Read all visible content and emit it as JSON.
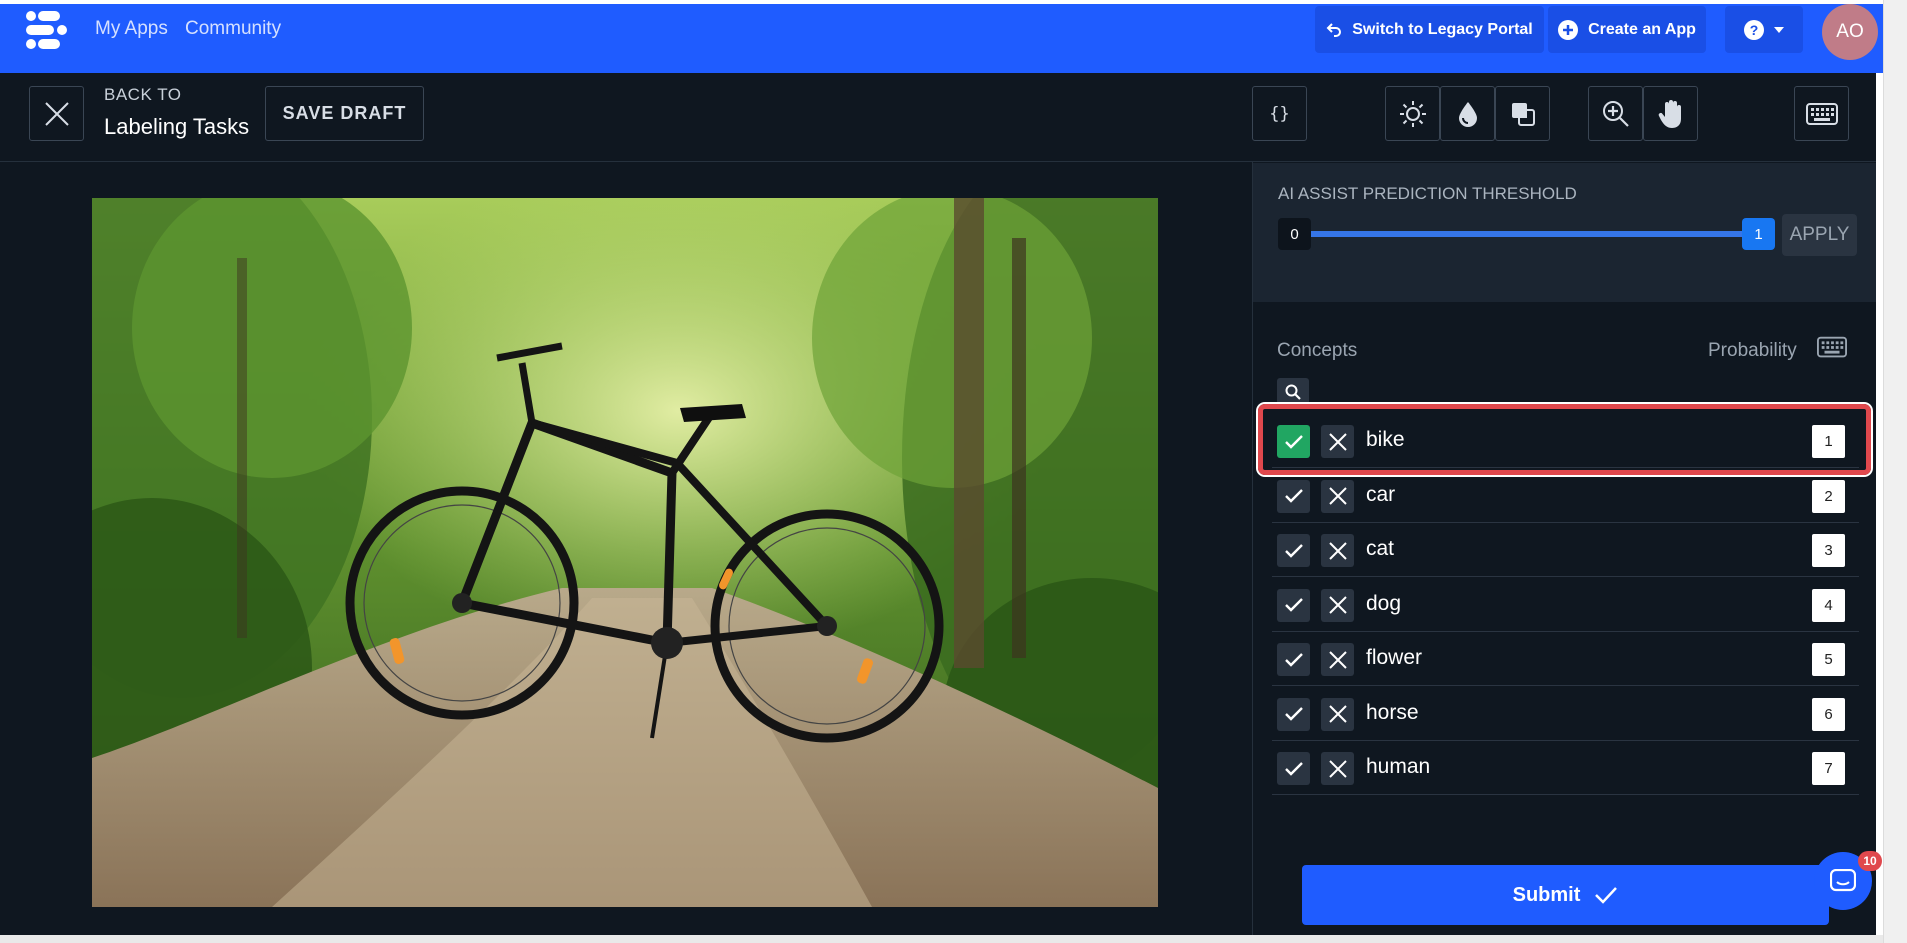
{
  "topnav": {
    "links": [
      "My Apps",
      "Community"
    ],
    "legacy_label": "Switch to Legacy Portal",
    "create_label": "Create an App",
    "avatar_initials": "AO",
    "bg_color": "#1f5cff"
  },
  "toolbar": {
    "back_small": "BACK TO",
    "back_title": "Labeling Tasks",
    "save_draft": "SAVE DRAFT",
    "icons": [
      "close-icon",
      "json-icon",
      "brightness-icon",
      "saturation-icon",
      "contrast-icon",
      "zoom-in-icon",
      "pan-hand-icon",
      "keyboard-icon"
    ]
  },
  "image": {
    "subject": "bike"
  },
  "threshold": {
    "title": "AI ASSIST PREDICTION THRESHOLD",
    "min": "0",
    "max": "1",
    "value": 1,
    "apply_label": "APPLY"
  },
  "concepts": {
    "header_concepts": "Concepts",
    "header_probability": "Probability",
    "items": [
      {
        "label": "bike",
        "shortcut": "1",
        "accepted": true
      },
      {
        "label": "car",
        "shortcut": "2",
        "accepted": false
      },
      {
        "label": "cat",
        "shortcut": "3",
        "accepted": false
      },
      {
        "label": "dog",
        "shortcut": "4",
        "accepted": false
      },
      {
        "label": "flower",
        "shortcut": "5",
        "accepted": false
      },
      {
        "label": "horse",
        "shortcut": "6",
        "accepted": false
      },
      {
        "label": "human",
        "shortcut": "7",
        "accepted": false
      }
    ]
  },
  "submit": {
    "label": "Submit"
  },
  "chat": {
    "badge_count": "10"
  },
  "colors": {
    "accent": "#1f5cff",
    "accept": "#21a662",
    "highlight": "#e0484d",
    "panel": "#0f1720"
  }
}
